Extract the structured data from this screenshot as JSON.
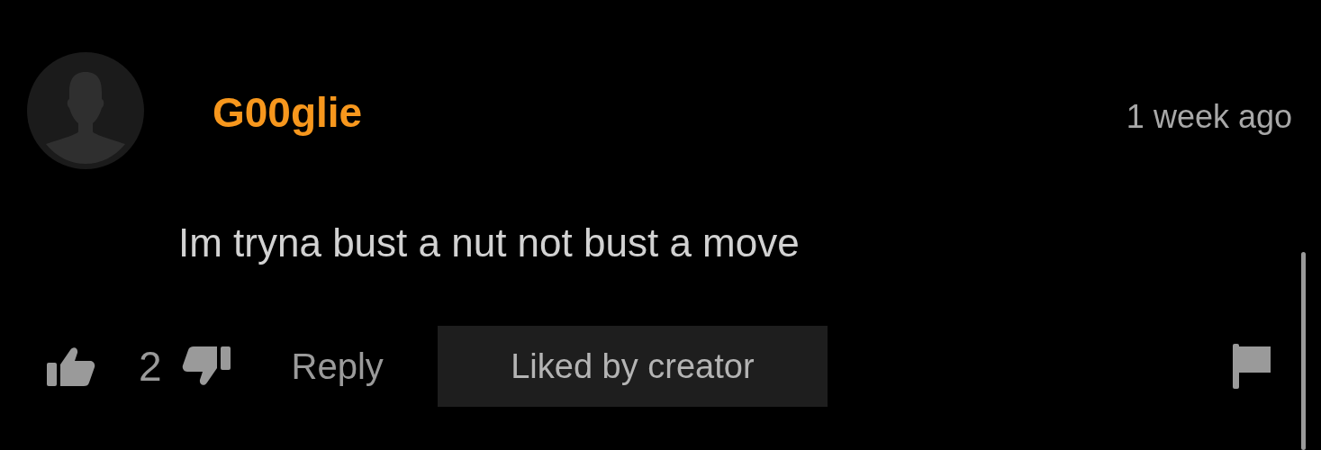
{
  "comment": {
    "author": "G00glie",
    "time": "1 week ago",
    "text": "Im tryna bust a nut not bust a move",
    "likes": "2",
    "reply_label": "Reply",
    "badge": "Liked by creator"
  }
}
